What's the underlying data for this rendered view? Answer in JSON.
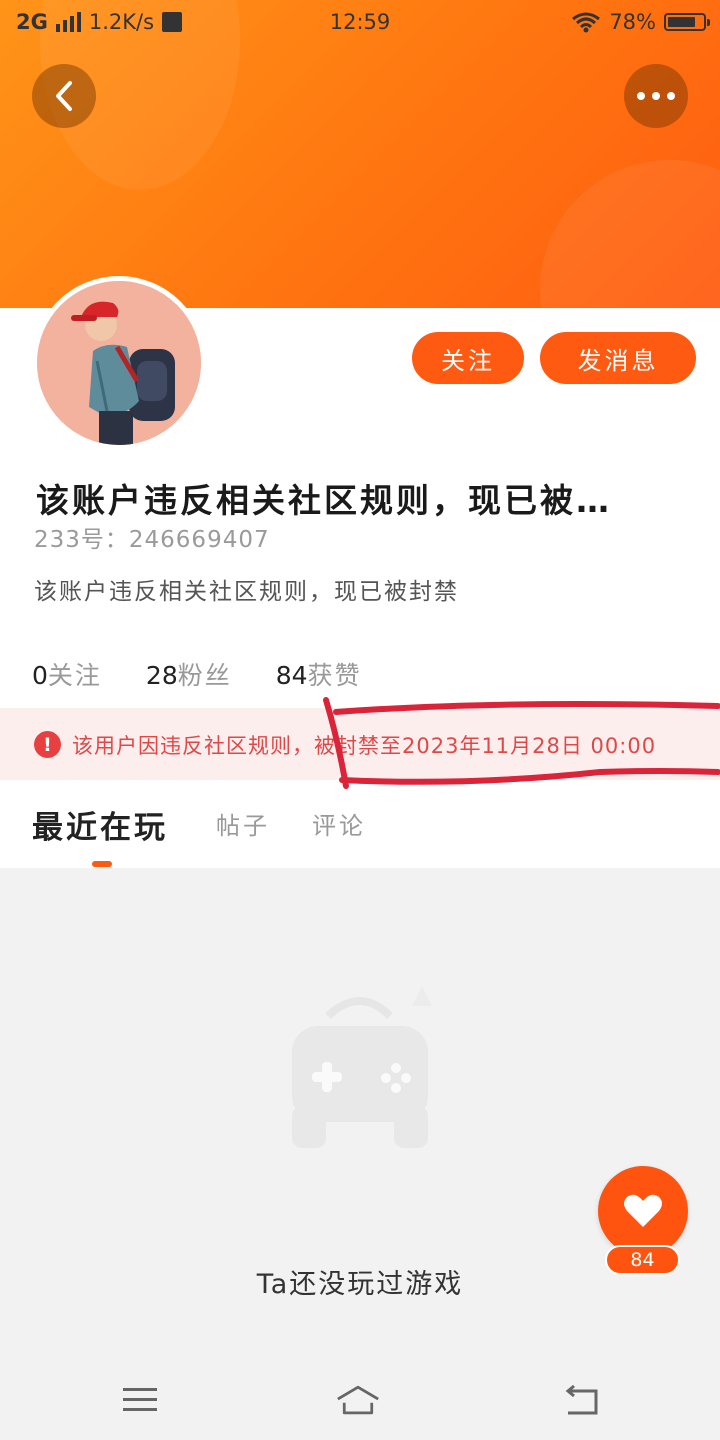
{
  "status_bar": {
    "network": "2G",
    "speed": "1.2K/s",
    "time": "12:59",
    "battery": "78%",
    "battery_level": 0.78
  },
  "header": {
    "back_icon": "chevron-left-icon",
    "more_icon": "more-dots-icon"
  },
  "profile": {
    "follow_label": "关注",
    "message_label": "发消息",
    "name": "该账户违反相关社区规则，现已被…",
    "uid": "233号：246669407",
    "bio": "该账户违反相关社区规则，现已被封禁",
    "stats": [
      {
        "num": "0",
        "label": "关注"
      },
      {
        "num": "28",
        "label": "粉丝"
      },
      {
        "num": "84",
        "label": "获赞"
      }
    ]
  },
  "ban_notice": {
    "icon": "alert-icon",
    "text": "该用户因违反社区规则，被封禁至2023年11月28日 00:00"
  },
  "tabs": [
    "最近在玩",
    "帖子",
    "评论"
  ],
  "active_tab": 0,
  "empty_state": {
    "icon": "gamepad-icon",
    "text": "Ta还没玩过游戏"
  },
  "like_button": {
    "icon": "heart-icon",
    "count": "84"
  },
  "nav_bar": {
    "menu_icon": "menu-icon",
    "home_icon": "home-icon",
    "back_icon": "return-icon"
  },
  "colors": {
    "accent": "#ff5a12",
    "header_gradient_start": "#ff9418",
    "warning_text": "#e04848",
    "annotation": "#d9243a"
  }
}
